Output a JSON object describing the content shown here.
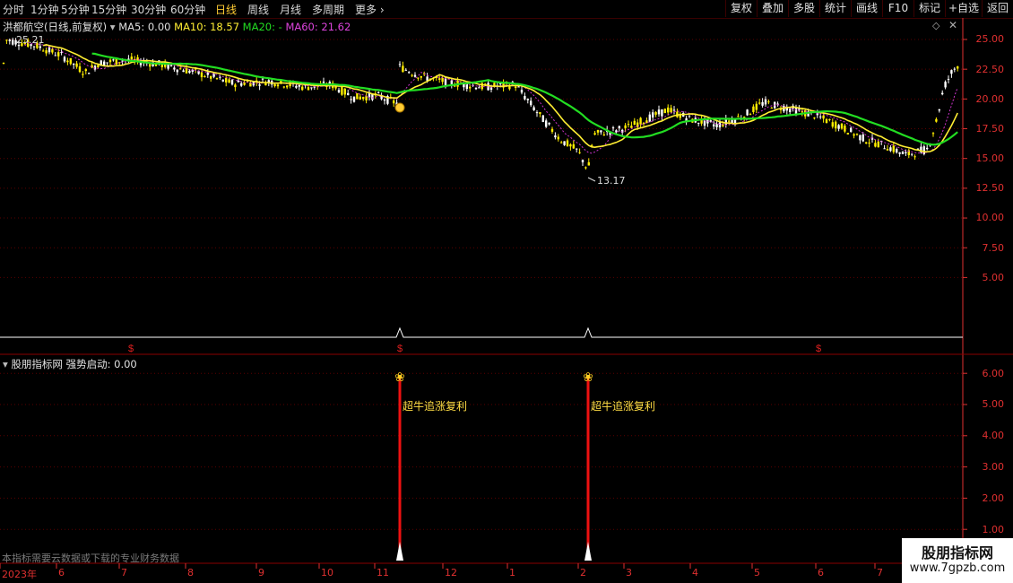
{
  "toolbar": {
    "timeframes": [
      "分时",
      "1分钟",
      "5分钟",
      "15分钟",
      "30分钟",
      "60分钟",
      "日线",
      "周线",
      "月线",
      "多周期",
      "更多"
    ],
    "active": "日线",
    "right_buttons": [
      "复权",
      "叠加",
      "多股",
      "统计",
      "画线",
      "F10",
      "标记",
      "+自选",
      "返回"
    ]
  },
  "main": {
    "stock_title": "洪都航空(日线,前复权)",
    "ma5": "MA5: 0.00",
    "ma10": "MA10: 18.57",
    "ma20": "MA20: -",
    "ma60": "MA60: 21.62",
    "high_label": "25.21",
    "low_label": "13.17",
    "y_ticks": [
      "25.00",
      "22.50",
      "20.00",
      "17.50",
      "15.00",
      "12.50",
      "10.00",
      "7.50",
      "5.00"
    ]
  },
  "indicator": {
    "title": "股朋指标网",
    "param": "强势启动: 0.00",
    "y_ticks": [
      "6.00",
      "5.00",
      "4.00",
      "3.00",
      "2.00",
      "1.00"
    ],
    "signal_text": "超牛追涨复利",
    "signals": [
      {
        "date_index": 0
      },
      {
        "date_index": 1
      }
    ]
  },
  "x_axis": {
    "labels": [
      "2023年",
      "6",
      "7",
      "8",
      "9",
      "10",
      "11",
      "12",
      "1",
      "2",
      "3",
      "4",
      "5",
      "6",
      "7"
    ]
  },
  "footnote": "本指标需要云数据或下载的专业财务数据",
  "watermark": {
    "name": "股朋指标网",
    "url": "www.7gpzb.com"
  },
  "colors": {
    "up": "#ffee00",
    "down": "#ffffff",
    "ma20": "#22dd22",
    "ma60": "#ffee33",
    "ma5": "#cc33cc",
    "axis": "#e03030",
    "signal": "#ee1111"
  }
}
